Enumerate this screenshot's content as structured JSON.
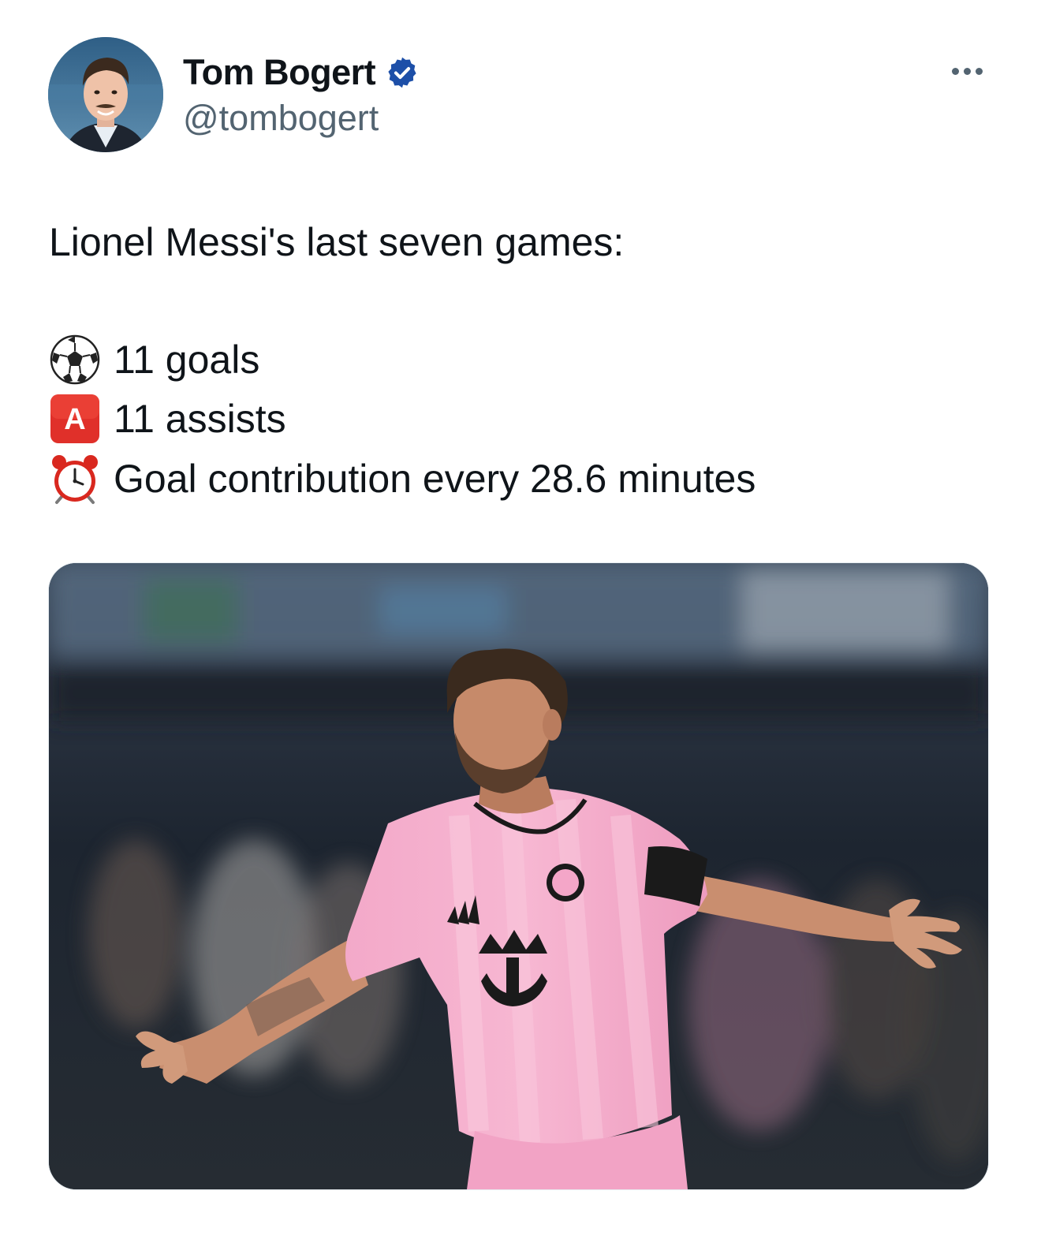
{
  "author": {
    "name": "Tom Bogert",
    "handle": "@tombogert",
    "verified": true,
    "verified_color": "#1d4fa8"
  },
  "tweet": {
    "text": "Lionel Messi's last seven games:",
    "stats": [
      {
        "icon": "soccer-ball-icon",
        "text": "11 goals"
      },
      {
        "icon": "letter-a-button-icon",
        "text": "11 assists"
      },
      {
        "icon": "alarm-clock-icon",
        "text": "Goal contribution every 28.6 minutes"
      }
    ]
  },
  "media": {
    "kit_color": "#f4a6c8"
  },
  "colors": {
    "text_primary": "#0f1419",
    "text_secondary": "#536471"
  }
}
